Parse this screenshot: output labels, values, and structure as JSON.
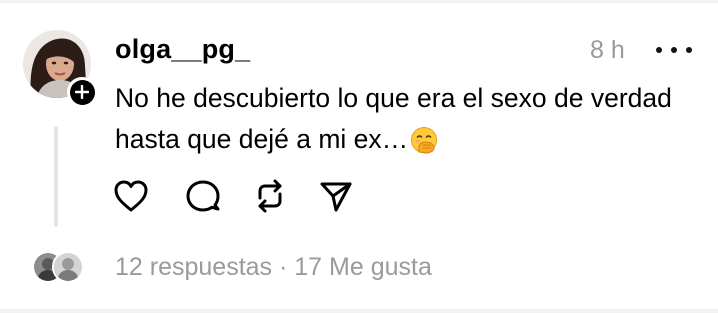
{
  "post": {
    "username": "olga__pg_",
    "timestamp": "8 h",
    "text": "No he descubierto lo que era el sexo de verdad hasta que dejé a mi ex…",
    "emoji": "face-with-hand-over-mouth"
  },
  "actions": {
    "like": "heart-icon",
    "reply": "comment-icon",
    "repost": "repost-icon",
    "share": "send-icon"
  },
  "footer": {
    "replies": "12 respuestas",
    "separator": "·",
    "likes": "17 Me gusta"
  },
  "colors": {
    "text": "#000000",
    "muted": "#9a9a9a",
    "thread_line": "#e5e5e5"
  }
}
